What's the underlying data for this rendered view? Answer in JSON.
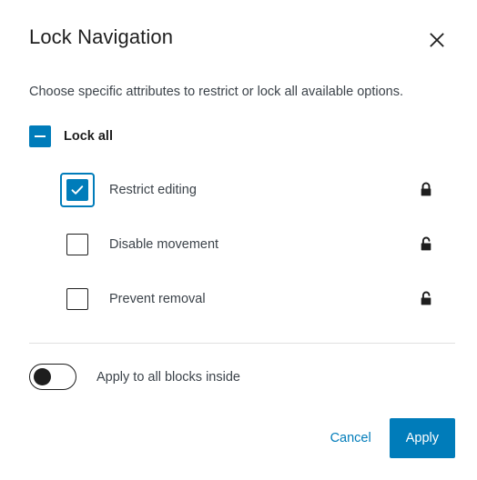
{
  "modal": {
    "title": "Lock Navigation",
    "close_icon": "close-icon",
    "description": "Choose specific attributes to restrict or lock all available options."
  },
  "lock_all": {
    "label": "Lock all",
    "state": "indeterminate",
    "icon": "minus-icon"
  },
  "attributes": [
    {
      "label": "Restrict editing",
      "checked": true,
      "focused": true,
      "lock_icon": "lock-closed-icon"
    },
    {
      "label": "Disable movement",
      "checked": false,
      "focused": false,
      "lock_icon": "lock-open-icon"
    },
    {
      "label": "Prevent removal",
      "checked": false,
      "focused": false,
      "lock_icon": "lock-open-icon"
    }
  ],
  "apply_inside": {
    "label": "Apply to all blocks inside",
    "enabled": false
  },
  "footer": {
    "cancel_label": "Cancel",
    "apply_label": "Apply"
  },
  "colors": {
    "accent": "#007cba",
    "text_primary": "#1e1e1e",
    "text_secondary": "#3c434a",
    "divider": "#e0e0e0",
    "surface": "#ffffff"
  }
}
